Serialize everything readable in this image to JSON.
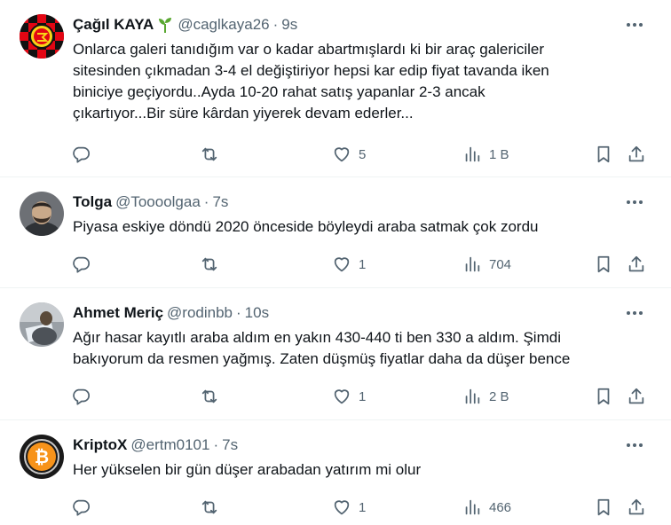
{
  "tweets": [
    {
      "name": "Çağıl KAYA",
      "handle": "@caglkaya26",
      "separator": "·",
      "time": "9s",
      "text": "Onlarca galeri tanıdığım var o kadar abartmışlardı ki bir araç galericiler\nsitesinden çıkmadan 3-4 el değiştiriyor hepsi kar edip fiyat tavanda iken\nbiniciye geçiyordu..Ayda 10-20 rahat satış yapanlar 2-3 ancak\nçıkartıyor...Bir süre kârdan yiyerek devam ederler...",
      "replies": "",
      "retweets": "",
      "likes": "5",
      "views": "1 B",
      "colors": {
        "avatar_primary": "#e30613",
        "avatar_secondary": "#111111",
        "avatar_accent": "#f7d417",
        "sprout": "#5aa832"
      }
    },
    {
      "name": "Tolga",
      "handle": "@Toooolgaa",
      "separator": "·",
      "time": "7s",
      "text": "Piyasa eskiye döndü 2020 önceside böyleydi araba satmak çok zordu",
      "replies": "",
      "retweets": "",
      "likes": "1",
      "views": "704",
      "colors": {
        "avatar_primary": "#3a3d42",
        "avatar_secondary": "#c9a98a"
      }
    },
    {
      "name": "Ahmet Meriç",
      "handle": "@rodinbb",
      "separator": "·",
      "time": "10s",
      "text": "Ağır hasar kayıtlı araba aldım en yakın 430-440 ti ben 330 a aldım. Şimdi\nbakıyorum da resmen yağmış. Zaten düşmüş fiyatlar daha da düşer bence",
      "replies": "",
      "retweets": "",
      "likes": "1",
      "views": "2 B",
      "colors": {
        "avatar_primary": "#8a8f96",
        "avatar_secondary": "#5a4a3a"
      }
    },
    {
      "name": "KriptoX",
      "handle": "@ertm0101",
      "separator": "·",
      "time": "7s",
      "text": "Her yükselen bir gün düşer arabadan yatırım mi olur",
      "replies": "",
      "retweets": "",
      "likes": "1",
      "views": "466",
      "colors": {
        "avatar_primary": "#f7931a",
        "avatar_secondary": "#1a1a1a"
      }
    }
  ],
  "icons": {
    "reply": "reply-icon",
    "retweet": "retweet-icon",
    "like": "heart-icon",
    "views": "views-chart-icon",
    "bookmark": "bookmark-icon",
    "share": "share-icon",
    "more": "more-icon"
  },
  "ui_colors": {
    "secondary_text": "#536471",
    "primary_text": "#0f1419",
    "divider": "#eff3f4"
  }
}
